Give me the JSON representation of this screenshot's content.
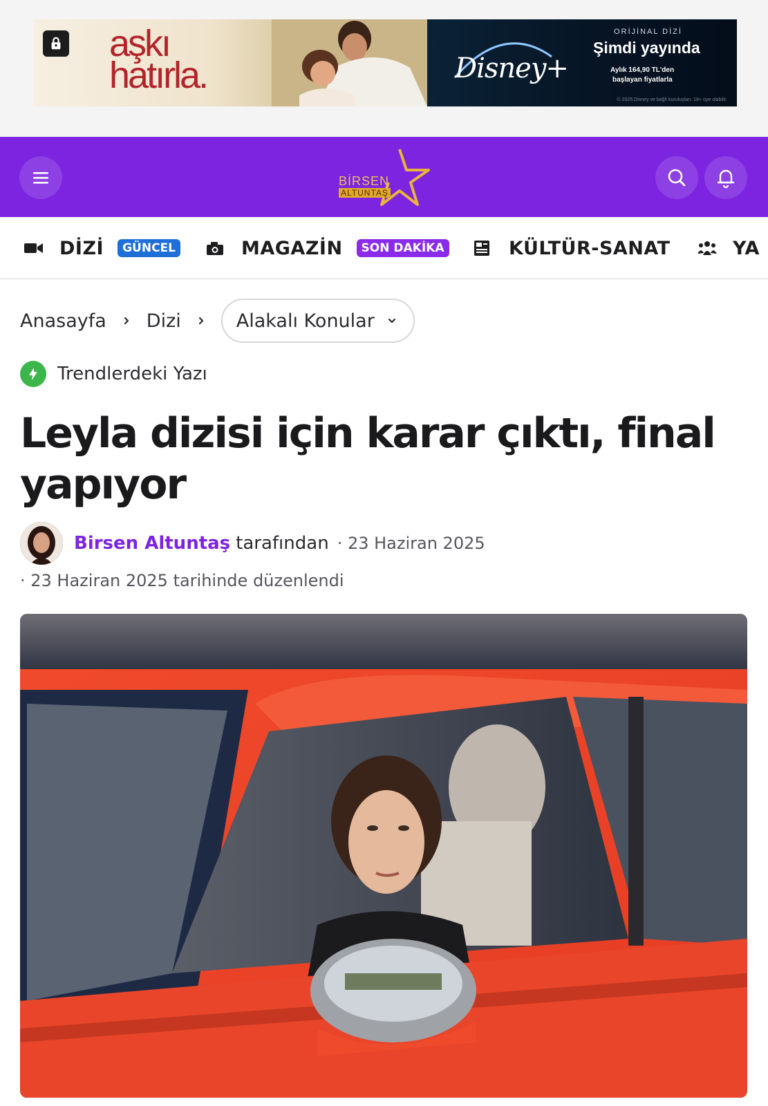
{
  "ad": {
    "title_line1": "aşkı",
    "title_line2": "hatırla.",
    "brand": "Disney+",
    "tagline_small": "ORİJİNAL DİZİ",
    "tagline_big": "Şimdi yayında",
    "price_line1": "Aylık 164,90 TL'den",
    "price_line2": "başlayan fiyatlarla",
    "legal": "© 2025 Disney ve bağlı kuruluşları. 18+ üye olabilir.",
    "colors": {
      "title": "#b3242a",
      "panel": "#061424"
    }
  },
  "header": {
    "logo_line1": "BİRSEN",
    "logo_line2": "ALTUNTAŞ",
    "menu_icon": "hamburger-icon",
    "search_icon": "search-icon",
    "bell_icon": "bell-icon",
    "background": "#7c24e0"
  },
  "categories": [
    {
      "label": "DİZİ",
      "icon": "video-camera-icon",
      "badge": "GÜNCEL",
      "badge_color": "#1f6fd8"
    },
    {
      "label": "MAGAZİN",
      "icon": "camera-icon",
      "badge": "SON DAKİKA",
      "badge_color": "#8b2bea"
    },
    {
      "label": "KÜLTÜR-SANAT",
      "icon": "newspaper-icon"
    },
    {
      "label": "YA",
      "icon": "people-icon"
    }
  ],
  "breadcrumb": {
    "home": "Anasayfa",
    "section": "Dizi",
    "related": "Alakalı Konular"
  },
  "trending": {
    "label": "Trendlerdeki Yazı",
    "icon": "lightning-icon",
    "color": "#3cb54a"
  },
  "article": {
    "title": "Leyla dizisi için karar çıktı, final yapıyor",
    "author": "Birsen Altuntaş",
    "by_suffix": "tarafından",
    "date": "· 23 Haziran 2025",
    "edited": "· 23 Haziran 2025 tarihinde düzenlendi"
  }
}
